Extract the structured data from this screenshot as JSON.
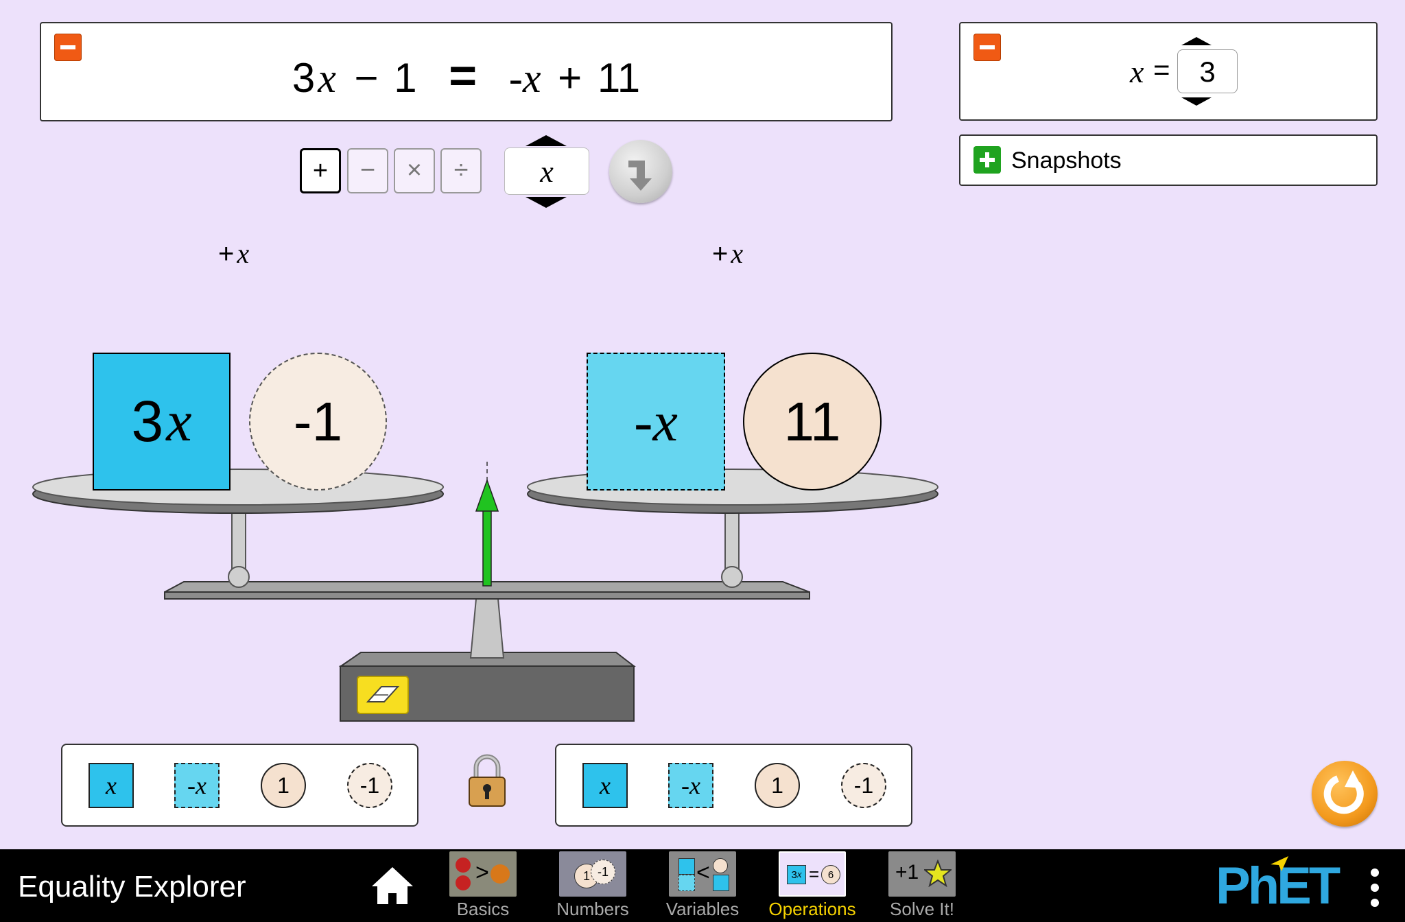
{
  "equation": {
    "left": {
      "coef": "3",
      "var": "x",
      "op": "−",
      "const": "1"
    },
    "equals": "=",
    "right": {
      "var_term": "-x",
      "op": "+",
      "const": "11"
    }
  },
  "variable_panel": {
    "var": "x",
    "equals": "=",
    "value": "3"
  },
  "snapshots": {
    "label": "Snapshots"
  },
  "operations": {
    "buttons": [
      "+",
      "−",
      "×",
      "÷"
    ],
    "selected": "+",
    "operand": "x"
  },
  "operation_labels": {
    "left": "+",
    "right": "+",
    "var": "x"
  },
  "left_pan": {
    "variable_tile": "3x",
    "variable_coef": "3",
    "variable_var": "x",
    "constant_tile": "-1"
  },
  "right_pan": {
    "variable_tile": "-x",
    "constant_tile": "11"
  },
  "toolboxes": {
    "left": {
      "x": "x",
      "neg_x": "-x",
      "one": "1",
      "neg_one": "-1"
    },
    "right": {
      "x": "x",
      "neg_x": "-x",
      "one": "1",
      "neg_one": "-1"
    }
  },
  "nav": {
    "app_title": "Equality Explorer",
    "tabs": [
      {
        "label": "Basics"
      },
      {
        "label": "Numbers"
      },
      {
        "label": "Variables"
      },
      {
        "label": "Operations"
      },
      {
        "label": "Solve It!"
      }
    ],
    "active_tab": "Operations",
    "brand": "PhET"
  },
  "tab_icons": {
    "basics_symbol": ">",
    "numbers_a": "1",
    "numbers_b": "-1",
    "variables_symbol": "<",
    "operations_eq": "3x = 6",
    "operations_left": "3",
    "operations_var": "x",
    "operations_eq_sign": "=",
    "operations_right": "6",
    "solve_it": "+1"
  },
  "colors": {
    "background": "#EDE1FB",
    "variable_tile": "#2EC2EC",
    "neg_variable_tile": "#66D6F0",
    "constant_tile": "#F5E1CF",
    "neg_constant_tile": "#F7ECE2",
    "minus_button": "#F05A14",
    "plus_button": "#1FA31F",
    "active_tab": "#F6D200",
    "balance_arrow": "#20C320",
    "reset_button": "#F39A1E"
  }
}
